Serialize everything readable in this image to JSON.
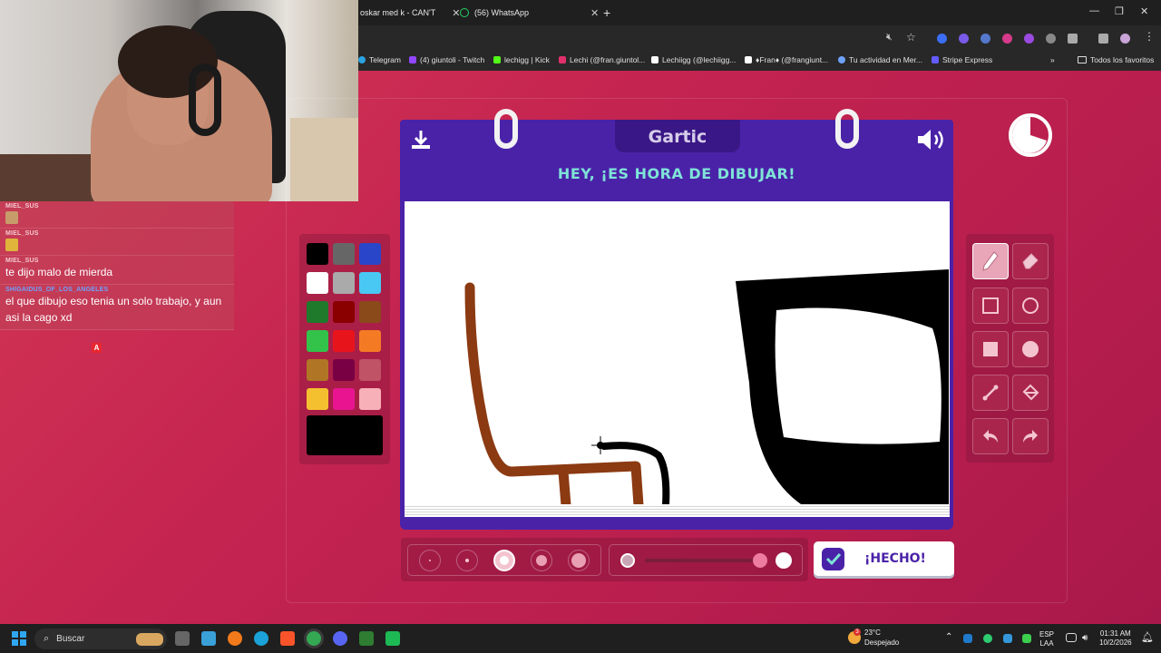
{
  "browser": {
    "tabs": [
      {
        "title": "oskar med k - CAN'T"
      },
      {
        "title": "(56) WhatsApp"
      }
    ],
    "bookmarks": [
      {
        "label": "Telegram",
        "color": "#2aa3df"
      },
      {
        "label": "(4) giuntoli - Twitch",
        "color": "#9146ff"
      },
      {
        "label": "lechigg | Kick",
        "color": "#53fc18"
      },
      {
        "label": "Lechi (@fran.giuntol...",
        "color": "#e1306c"
      },
      {
        "label": "Lechiigg (@lechiigg...",
        "color": "#ffffff"
      },
      {
        "label": "♦Fran♦ (@frangiunt...",
        "color": "#ffffff"
      },
      {
        "label": "Tu actividad en Mer...",
        "color": "#6ea2ff"
      },
      {
        "label": "Stripe Express",
        "color": "#635bff"
      }
    ],
    "bookmarks_folder": "Todos los favoritos"
  },
  "chat": {
    "messages": [
      {
        "user": "MIEL_SUS",
        "text": "",
        "emote": "face"
      },
      {
        "user": "MIEL_SUS",
        "text": "",
        "emote": "cat"
      },
      {
        "user": "MIEL_SUS",
        "text": "te dijo malo de mierda",
        "emote": ""
      },
      {
        "user": "SHIGAIDUS_OF_LOS_ANGELES",
        "text": "el que dibujo eso tenia un solo trabajo, y aun asi la cago xd",
        "emote": ""
      }
    ],
    "badge": "A"
  },
  "game": {
    "logo": "Gartic",
    "title": "HEY, ¡ES HORA DE DIBUJAR!",
    "done_label": "¡HECHO!",
    "palette": [
      "#000000",
      "#666666",
      "#2946c9",
      "#ffffff",
      "#aaaaaa",
      "#4ac8f4",
      "#1f7a2c",
      "#8a0000",
      "#8a4a1a",
      "#33c24a",
      "#e8141c",
      "#f47b24",
      "#b07626",
      "#7a0044",
      "#c05466",
      "#f5c030",
      "#e81490",
      "#f7b0b8"
    ],
    "current_color": "#000000",
    "accent": "#4a22a8",
    "title_color": "#7fe3d7",
    "tools": [
      "pencil-icon",
      "eraser-icon",
      "square-outline-icon",
      "circle-outline-icon",
      "square-filled-icon",
      "circle-filled-icon",
      "line-icon",
      "fill-bucket-icon",
      "undo-icon",
      "redo-icon"
    ],
    "brush_sizes_selected": 3,
    "opacity": 1
  },
  "taskbar": {
    "search_placeholder": "Buscar",
    "weather_temp": "23°C",
    "weather_desc": "Despejado",
    "weather_badge": "3",
    "lang_line1": "ESP",
    "lang_line2": "LAA",
    "time": "01:31 AM",
    "date": "10/2/2026"
  }
}
